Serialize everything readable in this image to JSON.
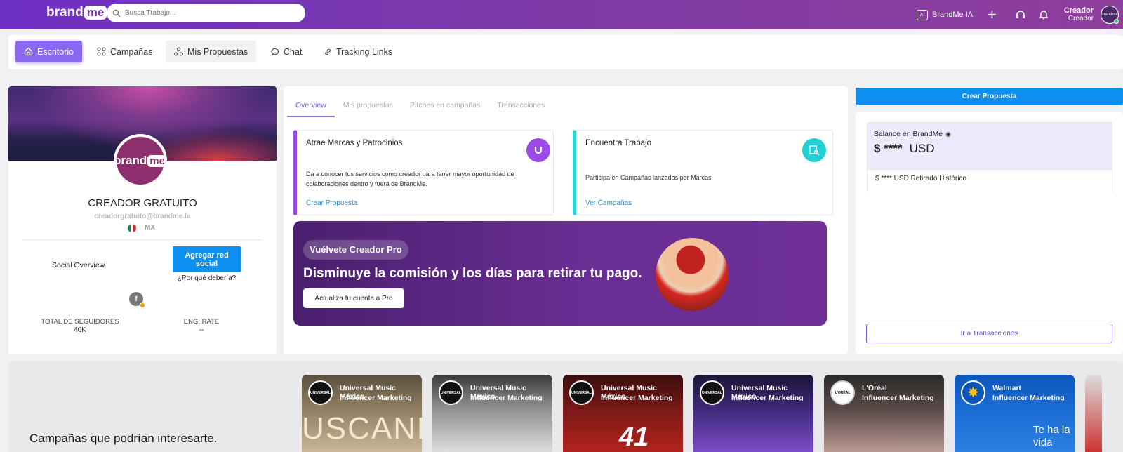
{
  "topbar": {
    "logo_brand": "brand",
    "logo_me": "me",
    "search_placeholder": "Busca Trabajo...",
    "ia_box": "AI",
    "ia_label": "BrandMe IA",
    "user_name": "Creador",
    "user_role": "Creador",
    "avatar_text": "brandme"
  },
  "nav": {
    "items": [
      "Escritorio",
      "Campañas",
      "Mis Propuestas",
      "Chat",
      "Tracking Links"
    ]
  },
  "profile": {
    "logo_brand": "brand",
    "logo_me": "me",
    "name": "CREADOR GRATUITO",
    "email": "creadorgratuito@brandme.la",
    "country": "MX",
    "social_overview": "Social Overview",
    "add_network_button": "Agregar red social",
    "why_link": "¿Por qué debería?",
    "followers_label": "TOTAL DE SEGUIDORES",
    "followers_value": "40K",
    "eng_label": "ENG. RATE",
    "eng_value": "--"
  },
  "center": {
    "tabs": [
      "Overview",
      "Mis propuestas",
      "Pitches en campañas",
      "Transacciones"
    ],
    "card1": {
      "title": "Atrae Marcas y Patrocinios",
      "text": "Da a conocer tus servicios como creador para tener mayor oportunidad de colaboraciones dentro y fuera de BrandMe.",
      "link": "Crear Propuesta"
    },
    "card2": {
      "title": "Encuentra Trabajo",
      "text": "Participa en Campañas lanzadas por Marcas",
      "link": "Ver Campañas"
    },
    "promo": {
      "pill": "Vuélvete Creador Pro",
      "headline": "Disminuye la comisión y los días para retirar tu pago.",
      "button": "Actualiza tu cuenta a Pro"
    }
  },
  "right": {
    "create_button": "Crear Propuesta",
    "balance_label": "Balance en BrandMe",
    "balance_value": "$ ****",
    "balance_currency": "USD",
    "withdrawn": "$ **** USD Retirado Histórico",
    "transactions_button": "Ir a Transacciones"
  },
  "campaigns": {
    "title": "Campañas que podrían interesarte.",
    "cards": [
      {
        "brand": "Universal Music México",
        "category": "Influencer Marketing",
        "logo": "UNIVERSAL",
        "image_text": "USCANDOLE"
      },
      {
        "brand": "Universal Music México",
        "category": "Influencer Marketing",
        "logo": "UNIVERSAL",
        "image_text": ""
      },
      {
        "brand": "Universal Music México",
        "category": "Influencer Marketing",
        "logo": "UNIVERSAL",
        "image_text": "41"
      },
      {
        "brand": "Universal Music México",
        "category": "Influencer Marketing",
        "logo": "UNIVERSAL",
        "image_text": ""
      },
      {
        "brand": "L'Oréal",
        "category": "Influencer Marketing",
        "logo": "L'ORÉAL",
        "image_text": ""
      },
      {
        "brand": "Walmart",
        "category": "Influencer Marketing",
        "logo": "✸",
        "image_text": "Te ha la vida"
      }
    ]
  }
}
